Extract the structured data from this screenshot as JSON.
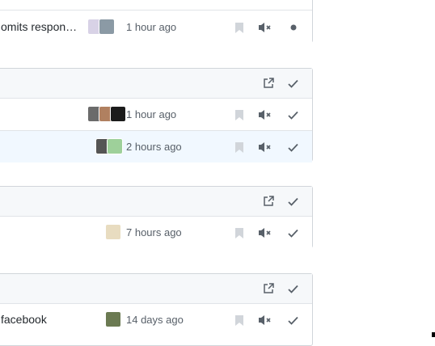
{
  "groups": [
    {
      "rows": [
        {
          "title": "omits respon…",
          "time": "1 hour ago",
          "status": "unread-dot"
        }
      ]
    },
    {
      "rows": [
        {
          "title": "",
          "time": "1 hour ago"
        },
        {
          "title": "",
          "time": "2 hours ago"
        }
      ]
    },
    {
      "rows": [
        {
          "title": "",
          "time": "7 hours ago"
        }
      ]
    },
    {
      "rows": [
        {
          "title": "facebook",
          "time": "14 days ago"
        }
      ]
    }
  ],
  "icons": {
    "bookmark": "bookmark-icon",
    "mute": "mute-icon",
    "check": "check-icon",
    "external": "external-link-icon",
    "dot": "unread-dot-icon"
  },
  "colors": {
    "header_bg": "#f6f8fa",
    "highlight_bg": "#f1f8ff",
    "border": "#d1d5da",
    "icon": "#586069",
    "icon_muted": "#c6cbd1"
  }
}
